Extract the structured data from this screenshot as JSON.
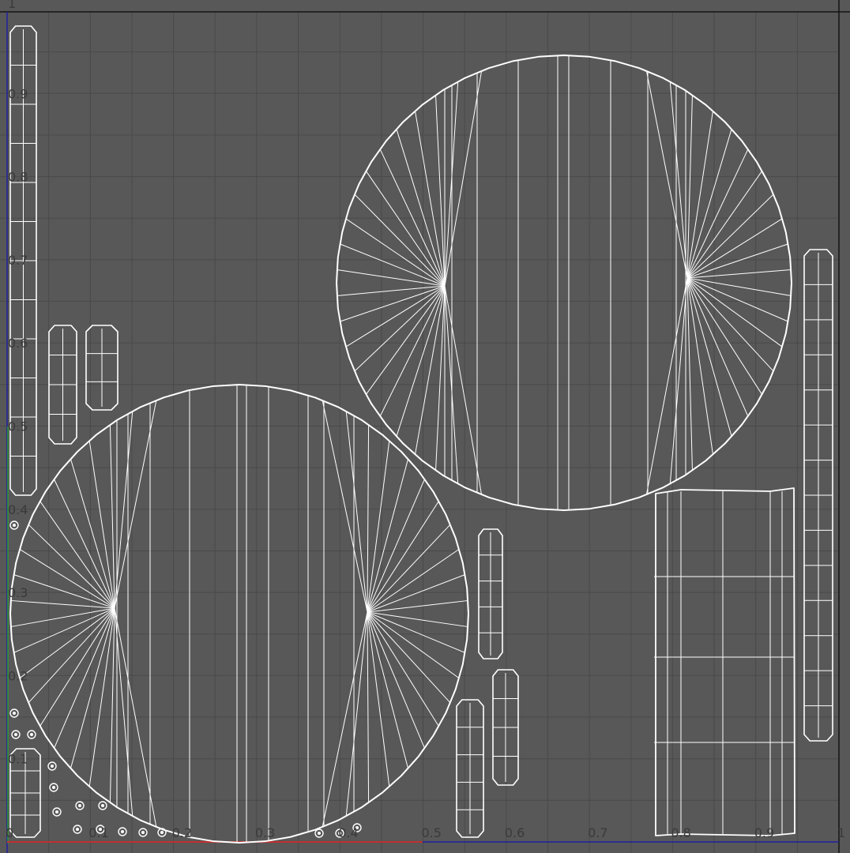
{
  "viewport": {
    "background": "#585858",
    "grid_color": "#4a4a4a",
    "wire_color": "#ffffff",
    "frame_color": "#141414",
    "u_axis_color": "#c03030",
    "v_axis_color": "#30a030",
    "left_edge_color": "#2020a0"
  },
  "axes": {
    "corner_label": "1",
    "u_ticks": [
      "0",
      "0.1",
      "0.2",
      "0.3",
      "0.4",
      "0.5",
      "0.6",
      "0.7",
      "0.8",
      "0.9",
      "1"
    ],
    "v_ticks": [
      "0.1",
      "0.2",
      "0.3",
      "0.4",
      "0.5",
      "0.6",
      "0.7",
      "0.8",
      "0.9"
    ]
  },
  "uv_islands": [
    "disc-top-right",
    "disc-bottom-left",
    "strip-left-long",
    "strip-left-short-a",
    "strip-left-short-b",
    "strip-left-bottom",
    "strip-center-a",
    "strip-center-b",
    "strip-center-c",
    "band-right",
    "strip-right-long",
    "small-pieces"
  ]
}
